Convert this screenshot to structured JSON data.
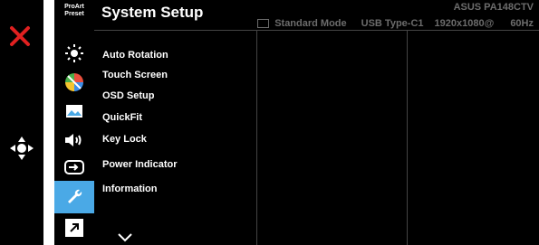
{
  "header": {
    "title": "System Setup",
    "model": "ASUS PA148CTV",
    "mode": "Standard Mode",
    "input": "USB Type-C1",
    "resolution": "1920x1080@",
    "refresh": "60Hz"
  },
  "side": {
    "preset_logo": [
      "ProArt",
      "Preset"
    ]
  },
  "menu": {
    "items": [
      "Auto Rotation",
      "Touch Screen",
      "OSD Setup",
      "QuickFit",
      "Key Lock",
      "Power Indicator",
      "Information"
    ]
  },
  "colors": {
    "accent": "#4aa9e6",
    "close": "#e02020",
    "status_text": "#6c6c6c"
  },
  "icons": {
    "close": "close-icon",
    "joystick": "joystick-icon",
    "more": "chevron-down-icon"
  }
}
